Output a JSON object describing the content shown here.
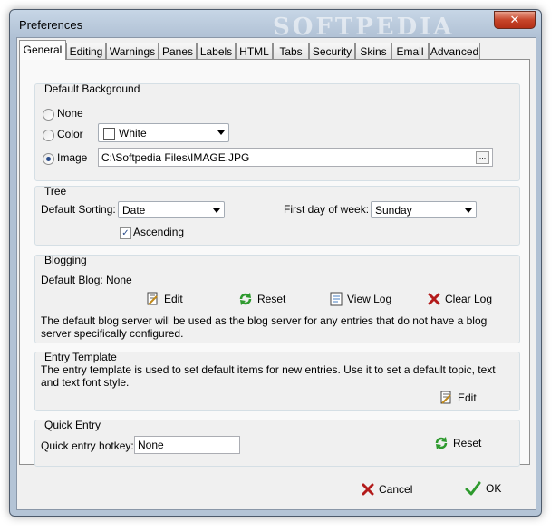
{
  "window": {
    "title": "Preferences",
    "watermark": "SOFTPEDIA",
    "close": "✕"
  },
  "tabs": [
    "General",
    "Editing",
    "Warnings",
    "Panes",
    "Labels",
    "HTML",
    "Tabs",
    "Security",
    "Skins",
    "Email",
    "Advanced"
  ],
  "default_background": {
    "title": "Default Background",
    "options": [
      "None",
      "Color",
      "Image"
    ],
    "selected": "Image",
    "color_value": "White",
    "image_path": "C:\\Softpedia Files\\IMAGE.JPG",
    "browse_label": "..."
  },
  "tree": {
    "title": "Tree",
    "sorting_label": "Default Sorting:",
    "sorting_value": "Date",
    "ascending_label": "Ascending",
    "ascending_checked": true,
    "week_label": "First day of week:",
    "week_value": "Sunday"
  },
  "blogging": {
    "title": "Blogging",
    "default_blog_label": "Default Blog:",
    "default_blog_value": "None",
    "edit_label": "Edit",
    "reset_label": "Reset",
    "view_log_label": "View Log",
    "clear_log_label": "Clear Log",
    "description": "The default blog server will be used as the blog server for any entries that do not have a blog server specifically configured."
  },
  "entry_template": {
    "title": "Entry Template",
    "description": "The entry template is used to set default items for new entries.  Use it to set a default topic, text and text font style.",
    "edit_label": "Edit"
  },
  "quick_entry": {
    "title": "Quick Entry",
    "hotkey_label": "Quick entry hotkey:",
    "hotkey_value": "None",
    "reset_label": "Reset"
  },
  "footer": {
    "cancel_label": "Cancel",
    "ok_label": "OK"
  },
  "colors": {
    "accent_green": "#2e9a2e",
    "cancel_red": "#b31b1b",
    "selection_blue": "#2a4c8a"
  }
}
